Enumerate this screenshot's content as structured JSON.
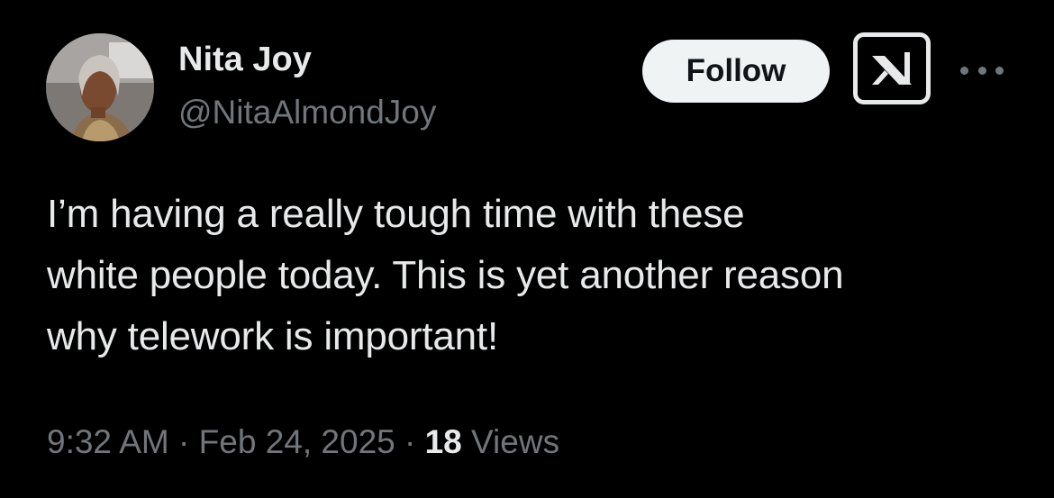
{
  "author": {
    "display_name": "Nita Joy",
    "handle": "@NitaAlmondJoy"
  },
  "actions": {
    "follow_label": "Follow",
    "grok_icon": "x-grok-icon",
    "more_icon": "more-horizontal-icon"
  },
  "tweet": {
    "lines": [
      "I’m having a really tough time with these",
      "white people today. This is yet another reason",
      "why telework is important!"
    ]
  },
  "meta": {
    "time": "9:32 AM",
    "separator": "·",
    "date": "Feb 24, 2025",
    "views_count": "18",
    "views_label": "Views"
  },
  "colors": {
    "background": "#000000",
    "primary_text": "#e7e9ea",
    "secondary_text": "#71767b",
    "follow_bg": "#eff3f4"
  }
}
